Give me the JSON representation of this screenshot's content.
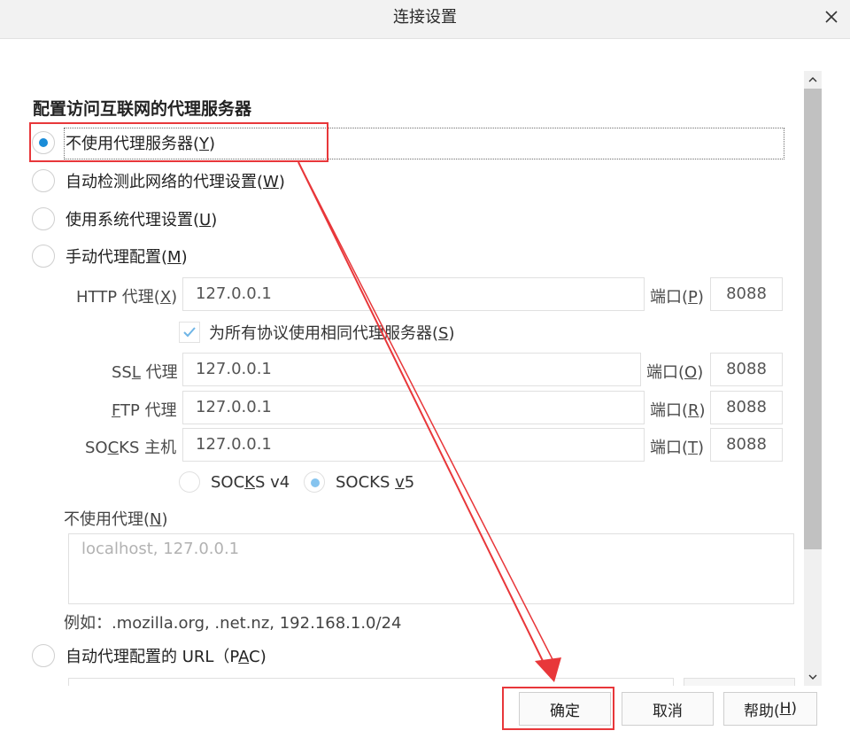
{
  "window": {
    "title": "连接设置",
    "close_icon": "close-icon"
  },
  "section": {
    "title": "配置访问互联网的代理服务器"
  },
  "proxy_modes": [
    {
      "label": "不使用代理服务器",
      "key": "Y",
      "checked": true
    },
    {
      "label": "自动检测此网络的代理设置",
      "key": "W",
      "checked": false
    },
    {
      "label": "使用系统代理设置",
      "key": "U",
      "checked": false
    },
    {
      "label": "手动代理配置",
      "key": "M",
      "checked": false
    }
  ],
  "manual": {
    "http": {
      "label_pre": "HTTP 代理(",
      "key": "X",
      "label_post": ")",
      "value": "127.0.0.1",
      "port_pre": "端口(",
      "port_key": "P",
      "port_post": ")",
      "port": "8088"
    },
    "same_for_all": {
      "label_pre": "为所有协议使用相同代理服务器(",
      "key": "S",
      "label_post": ")",
      "checked": true
    },
    "ssl": {
      "label_a": "SS",
      "key": "L",
      "label_b": " 代理",
      "value": "127.0.0.1",
      "port_pre": "端口(",
      "port_key": "O",
      "port_post": ")",
      "port": "8088"
    },
    "ftp": {
      "key": "F",
      "label_b": "TP 代理",
      "value": "127.0.0.1",
      "port_pre": "端口(",
      "port_key": "R",
      "port_post": ")",
      "port": "8088"
    },
    "socks": {
      "label_a": "SO",
      "key": "C",
      "label_b": "KS 主机",
      "value": "127.0.0.1",
      "port_pre": "端口(",
      "port_key": "T",
      "port_post": ")",
      "port": "8088"
    },
    "socks_v4": {
      "label_a": "SOC",
      "key": "K",
      "label_b": "S v4",
      "checked": false
    },
    "socks_v5": {
      "label_a": "SOCKS ",
      "key": "v",
      "label_b": "5",
      "checked": true
    }
  },
  "no_proxy": {
    "label_pre": "不使用代理(",
    "key": "N",
    "label_post": ")",
    "placeholder": "localhost, 127.0.0.1",
    "example": "例如：.mozilla.org, .net.nz, 192.168.1.0/24"
  },
  "pac": {
    "label_pre": "自动代理配置的 URL（P",
    "key": "A",
    "label_post": "C)",
    "checked": false
  },
  "footer": {
    "ok": "确定",
    "cancel": "取消",
    "help_pre": "帮助(",
    "help_key": "H",
    "help_post": ")"
  },
  "colors": {
    "accent": "#1a8cd8",
    "annotation": "#e8373a"
  }
}
